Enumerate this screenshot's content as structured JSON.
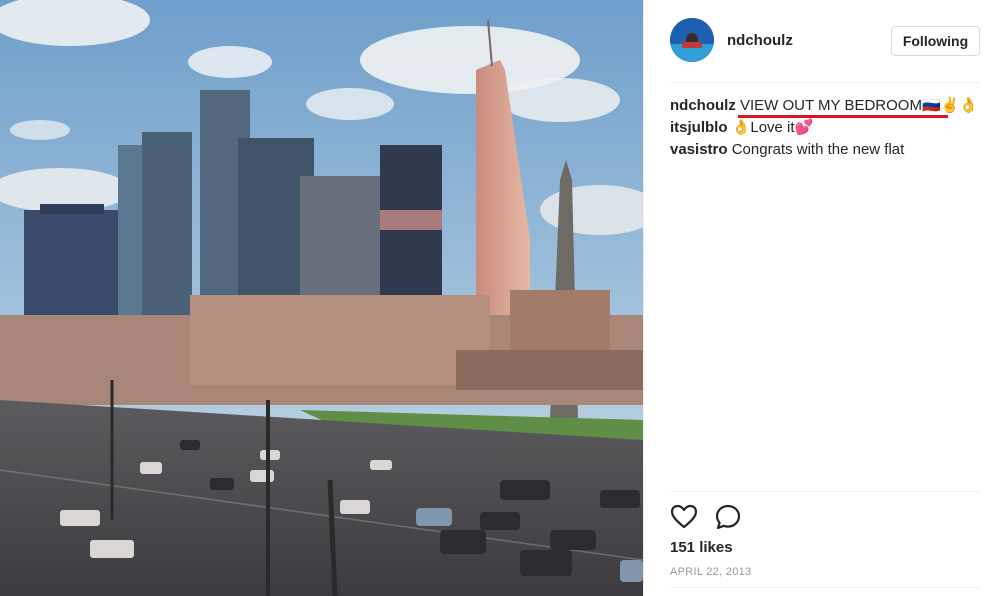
{
  "post": {
    "username": "ndchoulz",
    "follow_label": "Following",
    "caption_user": "ndchoulz",
    "caption_text": "VIEW OUT MY BEDROOM",
    "caption_emoji": "🇷🇺✌👌",
    "comments": [
      {
        "user": "itsjulblo",
        "text": "Love it",
        "pre_emoji": "👌",
        "post_emoji": "💕"
      },
      {
        "user": "vasistro",
        "text": "Congrats with the new flat"
      }
    ],
    "likes": "151 likes",
    "date": "APRIL 22, 2013"
  },
  "icons": {
    "like": "heart-icon",
    "comment": "comment-bubble-icon"
  },
  "colors": {
    "underline": "#e0141e",
    "text": "#262626",
    "muted": "#999999"
  }
}
